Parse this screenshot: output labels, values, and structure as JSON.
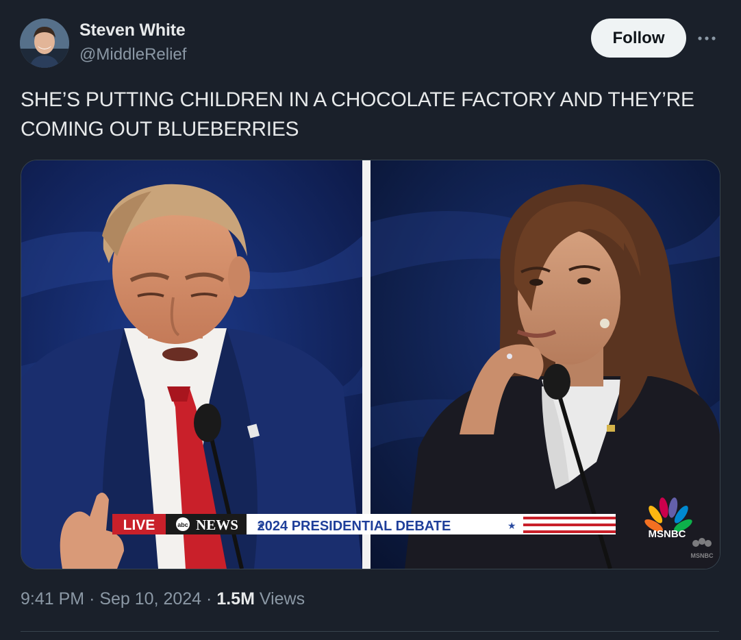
{
  "author": {
    "display_name": "Steven White",
    "handle": "@MiddleRelief"
  },
  "actions": {
    "follow_label": "Follow",
    "more_icon": "more-dots-icon"
  },
  "tweet": {
    "text": "SHE’S PUTTING CHILDREN IN A CHOCOLATE FACTORY AND THEY’RE COMING OUT BLUEBERRIES"
  },
  "media": {
    "banner": {
      "live": "LIVE",
      "network_logo": "abc",
      "network": "NEWS",
      "event": "2024 PRESIDENTIAL DEBATE"
    },
    "watermark": {
      "name": "MSNBC",
      "small": "MSNBC"
    }
  },
  "meta": {
    "time": "9:41 PM",
    "separator": "·",
    "date": "Sep 10, 2024",
    "views_count": "1.5M",
    "views_label": "Views"
  },
  "colors": {
    "background": "#1a202a",
    "text_primary": "#e7e9ea",
    "text_secondary": "#8b98a5",
    "follow_bg": "#eff3f4",
    "border": "#38444d"
  }
}
